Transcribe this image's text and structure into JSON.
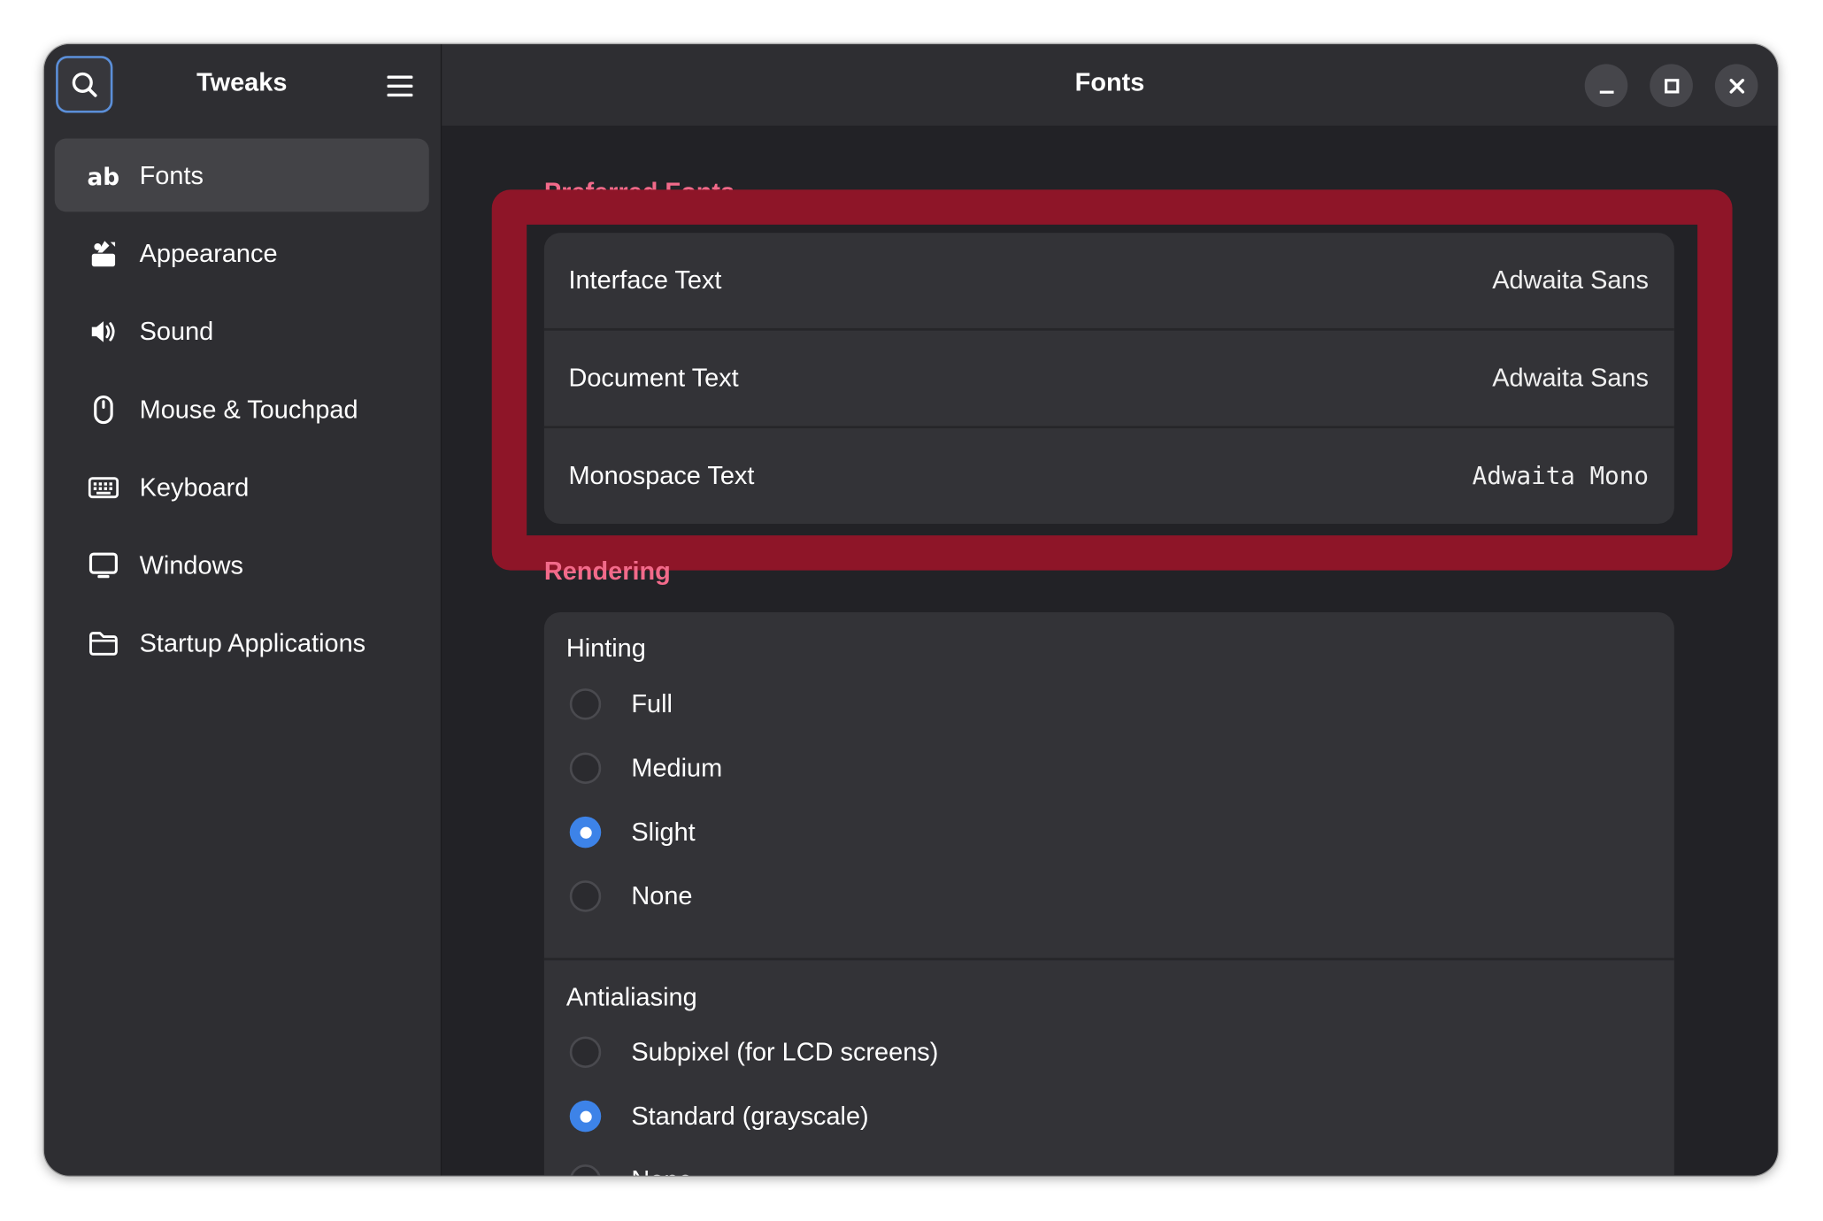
{
  "sidebar": {
    "title": "Tweaks",
    "items": [
      {
        "label": "Fonts",
        "icon": "fonts-ab-icon",
        "active": true
      },
      {
        "label": "Appearance",
        "icon": "appearance-icon"
      },
      {
        "label": "Sound",
        "icon": "speaker-icon"
      },
      {
        "label": "Mouse & Touchpad",
        "icon": "mouse-icon"
      },
      {
        "label": "Keyboard",
        "icon": "keyboard-icon"
      },
      {
        "label": "Windows",
        "icon": "monitor-icon"
      },
      {
        "label": "Startup Applications",
        "icon": "folder-icon"
      }
    ]
  },
  "header": {
    "title": "Fonts"
  },
  "preferred_fonts": {
    "title": "Preferred Fonts",
    "rows": [
      {
        "label": "Interface Text",
        "value": "Adwaita Sans"
      },
      {
        "label": "Document Text",
        "value": "Adwaita Sans"
      },
      {
        "label": "Monospace Text",
        "value": "Adwaita Mono"
      }
    ]
  },
  "rendering": {
    "title": "Rendering",
    "hinting": {
      "title": "Hinting",
      "options": [
        "Full",
        "Medium",
        "Slight",
        "None"
      ],
      "selected": "Slight"
    },
    "antialiasing": {
      "title": "Antialiasing",
      "options": [
        "Subpixel (for LCD screens)",
        "Standard (grayscale)",
        "None"
      ],
      "selected": "Standard (grayscale)"
    }
  },
  "colors": {
    "accent": "#3d83e8",
    "section_title": "#f26a8a",
    "highlight": "#8e1528",
    "window_bg": "#222226",
    "sidebar_bg": "#2e2e32",
    "card_bg": "#333337"
  }
}
